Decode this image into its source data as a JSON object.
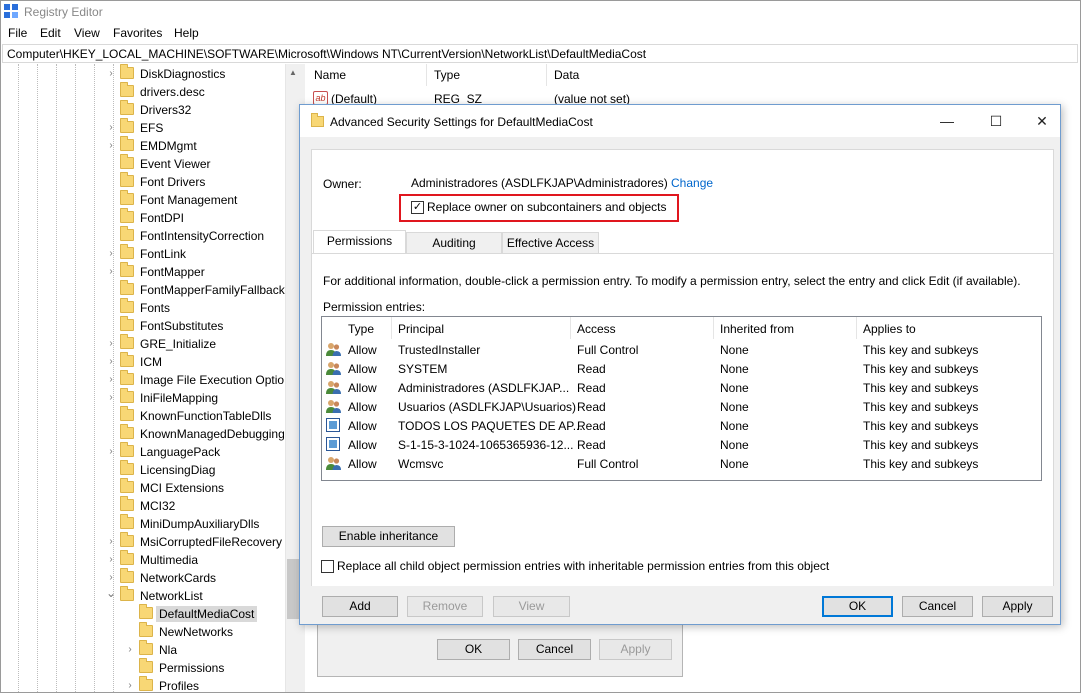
{
  "regedit": {
    "title": "Registry Editor",
    "menu": [
      "File",
      "Edit",
      "View",
      "Favorites",
      "Help"
    ],
    "address": "Computer\\HKEY_LOCAL_MACHINE\\SOFTWARE\\Microsoft\\Windows NT\\CurrentVersion\\NetworkList\\DefaultMediaCost",
    "tree": [
      {
        "label": "DiskDiagnostics",
        "expandable": true,
        "level": 0
      },
      {
        "label": "drivers.desc",
        "expandable": false,
        "level": 0
      },
      {
        "label": "Drivers32",
        "expandable": false,
        "level": 0
      },
      {
        "label": "EFS",
        "expandable": true,
        "level": 0
      },
      {
        "label": "EMDMgmt",
        "expandable": true,
        "level": 0
      },
      {
        "label": "Event Viewer",
        "expandable": false,
        "level": 0
      },
      {
        "label": "Font Drivers",
        "expandable": false,
        "level": 0
      },
      {
        "label": "Font Management",
        "expandable": false,
        "level": 0
      },
      {
        "label": "FontDPI",
        "expandable": false,
        "level": 0
      },
      {
        "label": "FontIntensityCorrection",
        "expandable": false,
        "level": 0
      },
      {
        "label": "FontLink",
        "expandable": true,
        "level": 0
      },
      {
        "label": "FontMapper",
        "expandable": true,
        "level": 0
      },
      {
        "label": "FontMapperFamilyFallback",
        "expandable": false,
        "level": 0
      },
      {
        "label": "Fonts",
        "expandable": false,
        "level": 0
      },
      {
        "label": "FontSubstitutes",
        "expandable": false,
        "level": 0
      },
      {
        "label": "GRE_Initialize",
        "expandable": true,
        "level": 0
      },
      {
        "label": "ICM",
        "expandable": true,
        "level": 0
      },
      {
        "label": "Image File Execution Optio",
        "expandable": true,
        "level": 0
      },
      {
        "label": "IniFileMapping",
        "expandable": true,
        "level": 0
      },
      {
        "label": "KnownFunctionTableDlls",
        "expandable": false,
        "level": 0
      },
      {
        "label": "KnownManagedDebugging",
        "expandable": false,
        "level": 0
      },
      {
        "label": "LanguagePack",
        "expandable": true,
        "level": 0
      },
      {
        "label": "LicensingDiag",
        "expandable": false,
        "level": 0
      },
      {
        "label": "MCI Extensions",
        "expandable": false,
        "level": 0
      },
      {
        "label": "MCI32",
        "expandable": false,
        "level": 0
      },
      {
        "label": "MiniDumpAuxiliaryDlls",
        "expandable": false,
        "level": 0
      },
      {
        "label": "MsiCorruptedFileRecovery",
        "expandable": true,
        "level": 0
      },
      {
        "label": "Multimedia",
        "expandable": true,
        "level": 0
      },
      {
        "label": "NetworkCards",
        "expandable": true,
        "level": 0
      },
      {
        "label": "NetworkList",
        "expandable": true,
        "expanded": true,
        "level": 0
      },
      {
        "label": "DefaultMediaCost",
        "expandable": false,
        "level": 1,
        "selected": true
      },
      {
        "label": "NewNetworks",
        "expandable": false,
        "level": 1
      },
      {
        "label": "Nla",
        "expandable": true,
        "level": 1
      },
      {
        "label": "Permissions",
        "expandable": false,
        "level": 1
      },
      {
        "label": "Profiles",
        "expandable": true,
        "level": 1
      }
    ],
    "list": {
      "columns": [
        "Name",
        "Type",
        "Data"
      ],
      "rows": [
        {
          "name": "(Default)",
          "type": "REG_SZ",
          "data": "(value not set)"
        }
      ]
    },
    "bg_dialog": {
      "ok": "OK",
      "cancel": "Cancel",
      "apply": "Apply"
    }
  },
  "adv": {
    "title": "Advanced Security Settings for DefaultMediaCost",
    "owner_label": "Owner:",
    "owner_value": "Administradores (ASDLFKJAP\\Administradores)",
    "change_link": "Change",
    "replace_owner_label": "Replace owner on subcontainers and objects",
    "replace_owner_checked": true,
    "tabs": [
      "Permissions",
      "Auditing",
      "Effective Access"
    ],
    "active_tab": "Permissions",
    "info_text": "For additional information, double-click a permission entry. To modify a permission entry, select the entry and click Edit (if available).",
    "entries_label": "Permission entries:",
    "columns": [
      "Type",
      "Principal",
      "Access",
      "Inherited from",
      "Applies to"
    ],
    "entries": [
      {
        "icon": "user-group-icon",
        "type": "Allow",
        "principal": "TrustedInstaller",
        "access": "Full Control",
        "inherited": "None",
        "applies": "This key and subkeys"
      },
      {
        "icon": "user-group-icon",
        "type": "Allow",
        "principal": "SYSTEM",
        "access": "Read",
        "inherited": "None",
        "applies": "This key and subkeys"
      },
      {
        "icon": "user-group-icon",
        "type": "Allow",
        "principal": "Administradores (ASDLFKJAP...",
        "access": "Read",
        "inherited": "None",
        "applies": "This key and subkeys"
      },
      {
        "icon": "user-group-icon",
        "type": "Allow",
        "principal": "Usuarios (ASDLFKJAP\\Usuarios)",
        "access": "Read",
        "inherited": "None",
        "applies": "This key and subkeys"
      },
      {
        "icon": "app-package-icon",
        "type": "Allow",
        "principal": "TODOS LOS PAQUETES DE AP...",
        "access": "Read",
        "inherited": "None",
        "applies": "This key and subkeys"
      },
      {
        "icon": "app-package-icon",
        "type": "Allow",
        "principal": "S-1-15-3-1024-1065365936-12...",
        "access": "Read",
        "inherited": "None",
        "applies": "This key and subkeys"
      },
      {
        "icon": "user-group-icon",
        "type": "Allow",
        "principal": "Wcmsvc",
        "access": "Full Control",
        "inherited": "None",
        "applies": "This key and subkeys"
      }
    ],
    "buttons": {
      "add": "Add",
      "remove": "Remove",
      "view": "View",
      "enable_inheritance": "Enable inheritance"
    },
    "replace_child_label": "Replace all child object permission entries with inheritable permission entries from this object",
    "replace_child_checked": false,
    "footer": {
      "ok": "OK",
      "cancel": "Cancel",
      "apply": "Apply"
    },
    "highlight_color": "#e0161e"
  }
}
